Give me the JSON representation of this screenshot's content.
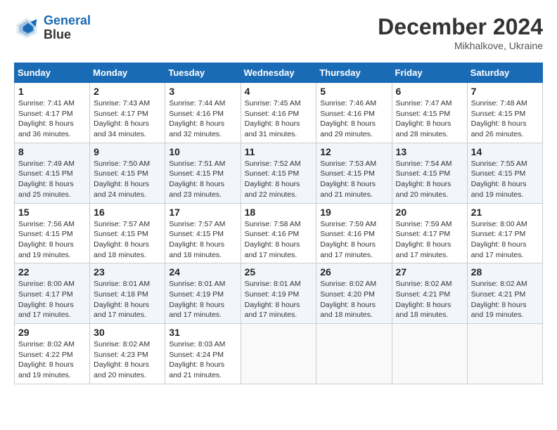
{
  "header": {
    "logo_line1": "General",
    "logo_line2": "Blue",
    "month_title": "December 2024",
    "subtitle": "Mikhalkove, Ukraine"
  },
  "weekdays": [
    "Sunday",
    "Monday",
    "Tuesday",
    "Wednesday",
    "Thursday",
    "Friday",
    "Saturday"
  ],
  "weeks": [
    [
      {
        "day": "1",
        "sunrise": "7:41 AM",
        "sunset": "4:17 PM",
        "daylight": "8 hours and 36 minutes."
      },
      {
        "day": "2",
        "sunrise": "7:43 AM",
        "sunset": "4:17 PM",
        "daylight": "8 hours and 34 minutes."
      },
      {
        "day": "3",
        "sunrise": "7:44 AM",
        "sunset": "4:16 PM",
        "daylight": "8 hours and 32 minutes."
      },
      {
        "day": "4",
        "sunrise": "7:45 AM",
        "sunset": "4:16 PM",
        "daylight": "8 hours and 31 minutes."
      },
      {
        "day": "5",
        "sunrise": "7:46 AM",
        "sunset": "4:16 PM",
        "daylight": "8 hours and 29 minutes."
      },
      {
        "day": "6",
        "sunrise": "7:47 AM",
        "sunset": "4:15 PM",
        "daylight": "8 hours and 28 minutes."
      },
      {
        "day": "7",
        "sunrise": "7:48 AM",
        "sunset": "4:15 PM",
        "daylight": "8 hours and 26 minutes."
      }
    ],
    [
      {
        "day": "8",
        "sunrise": "7:49 AM",
        "sunset": "4:15 PM",
        "daylight": "8 hours and 25 minutes."
      },
      {
        "day": "9",
        "sunrise": "7:50 AM",
        "sunset": "4:15 PM",
        "daylight": "8 hours and 24 minutes."
      },
      {
        "day": "10",
        "sunrise": "7:51 AM",
        "sunset": "4:15 PM",
        "daylight": "8 hours and 23 minutes."
      },
      {
        "day": "11",
        "sunrise": "7:52 AM",
        "sunset": "4:15 PM",
        "daylight": "8 hours and 22 minutes."
      },
      {
        "day": "12",
        "sunrise": "7:53 AM",
        "sunset": "4:15 PM",
        "daylight": "8 hours and 21 minutes."
      },
      {
        "day": "13",
        "sunrise": "7:54 AM",
        "sunset": "4:15 PM",
        "daylight": "8 hours and 20 minutes."
      },
      {
        "day": "14",
        "sunrise": "7:55 AM",
        "sunset": "4:15 PM",
        "daylight": "8 hours and 19 minutes."
      }
    ],
    [
      {
        "day": "15",
        "sunrise": "7:56 AM",
        "sunset": "4:15 PM",
        "daylight": "8 hours and 19 minutes."
      },
      {
        "day": "16",
        "sunrise": "7:57 AM",
        "sunset": "4:15 PM",
        "daylight": "8 hours and 18 minutes."
      },
      {
        "day": "17",
        "sunrise": "7:57 AM",
        "sunset": "4:15 PM",
        "daylight": "8 hours and 18 minutes."
      },
      {
        "day": "18",
        "sunrise": "7:58 AM",
        "sunset": "4:16 PM",
        "daylight": "8 hours and 17 minutes."
      },
      {
        "day": "19",
        "sunrise": "7:59 AM",
        "sunset": "4:16 PM",
        "daylight": "8 hours and 17 minutes."
      },
      {
        "day": "20",
        "sunrise": "7:59 AM",
        "sunset": "4:17 PM",
        "daylight": "8 hours and 17 minutes."
      },
      {
        "day": "21",
        "sunrise": "8:00 AM",
        "sunset": "4:17 PM",
        "daylight": "8 hours and 17 minutes."
      }
    ],
    [
      {
        "day": "22",
        "sunrise": "8:00 AM",
        "sunset": "4:17 PM",
        "daylight": "8 hours and 17 minutes."
      },
      {
        "day": "23",
        "sunrise": "8:01 AM",
        "sunset": "4:18 PM",
        "daylight": "8 hours and 17 minutes."
      },
      {
        "day": "24",
        "sunrise": "8:01 AM",
        "sunset": "4:19 PM",
        "daylight": "8 hours and 17 minutes."
      },
      {
        "day": "25",
        "sunrise": "8:01 AM",
        "sunset": "4:19 PM",
        "daylight": "8 hours and 17 minutes."
      },
      {
        "day": "26",
        "sunrise": "8:02 AM",
        "sunset": "4:20 PM",
        "daylight": "8 hours and 18 minutes."
      },
      {
        "day": "27",
        "sunrise": "8:02 AM",
        "sunset": "4:21 PM",
        "daylight": "8 hours and 18 minutes."
      },
      {
        "day": "28",
        "sunrise": "8:02 AM",
        "sunset": "4:21 PM",
        "daylight": "8 hours and 19 minutes."
      }
    ],
    [
      {
        "day": "29",
        "sunrise": "8:02 AM",
        "sunset": "4:22 PM",
        "daylight": "8 hours and 19 minutes."
      },
      {
        "day": "30",
        "sunrise": "8:02 AM",
        "sunset": "4:23 PM",
        "daylight": "8 hours and 20 minutes."
      },
      {
        "day": "31",
        "sunrise": "8:03 AM",
        "sunset": "4:24 PM",
        "daylight": "8 hours and 21 minutes."
      },
      null,
      null,
      null,
      null
    ]
  ]
}
